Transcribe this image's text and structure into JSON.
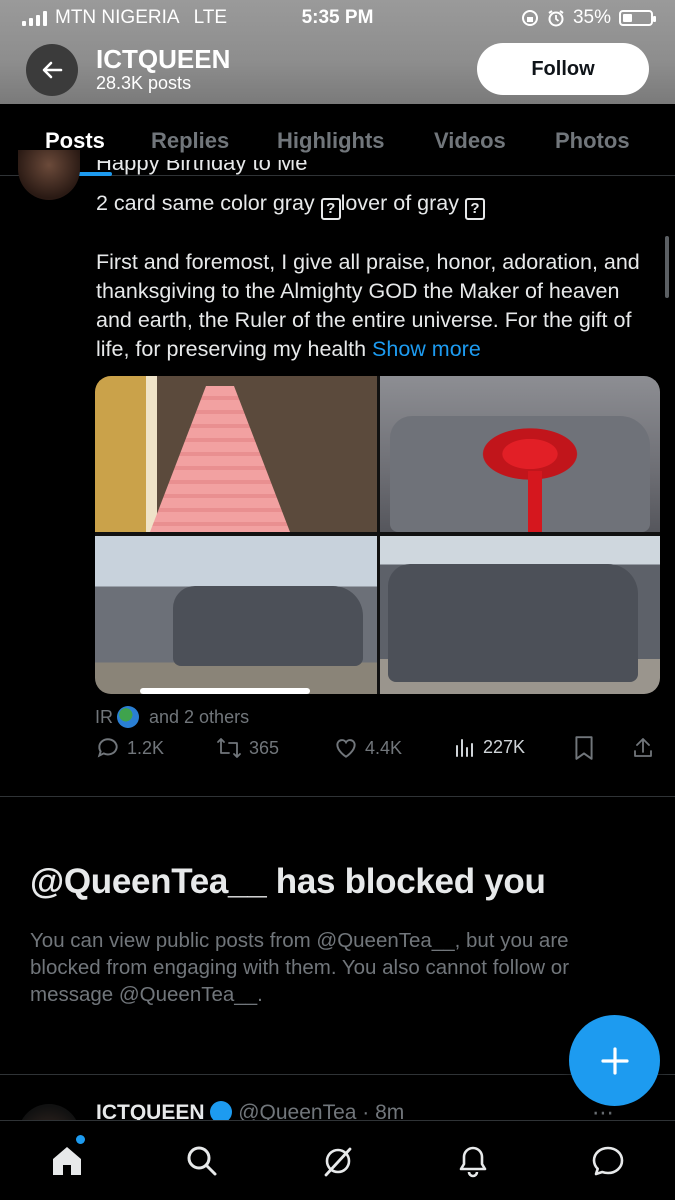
{
  "status_bar": {
    "carrier": "MTN NIGERIA",
    "network": "LTE",
    "time": "5:35 PM",
    "battery": "35%",
    "battery_level": 0.35
  },
  "header": {
    "name": "ICTQUEEN",
    "post_count": "28.3K posts",
    "follow_label": "Follow"
  },
  "tabs": [
    {
      "label": "Posts",
      "active": true
    },
    {
      "label": "Replies",
      "active": false
    },
    {
      "label": "Highlights",
      "active": false
    },
    {
      "label": "Videos",
      "active": false
    },
    {
      "label": "Photos",
      "active": false
    }
  ],
  "post": {
    "cut_line": "Happy Birthday to Me",
    "line2_a": "2 card same color gray ",
    "line2_b": "lover of gray ",
    "unknown_glyph": "?",
    "body": "First and foremost, I give all praise, honor, adoration, and thanksgiving to the Almighty GOD the Maker of heaven and earth, the Ruler of the entire universe. For the gift of life, for preserving my health",
    "show_more": "Show more",
    "liked_by_prefix": "IR",
    "liked_by_suffix": "and 2 others",
    "replies": "1.2K",
    "reposts": "365",
    "likes": "4.4K",
    "views": "227K"
  },
  "blocked": {
    "title": "@QueenTea__ has blocked you",
    "description": "You can view public posts from @QueenTea__, but you are blocked from engaging with them. You also cannot follow or message @QueenTea__."
  },
  "next_post": {
    "name": "ICTQUEEN",
    "handle": "@QueenTea",
    "time": "· 8m"
  },
  "colors": {
    "accent": "#1d9bf0",
    "background": "#000000",
    "muted": "#71767b"
  }
}
